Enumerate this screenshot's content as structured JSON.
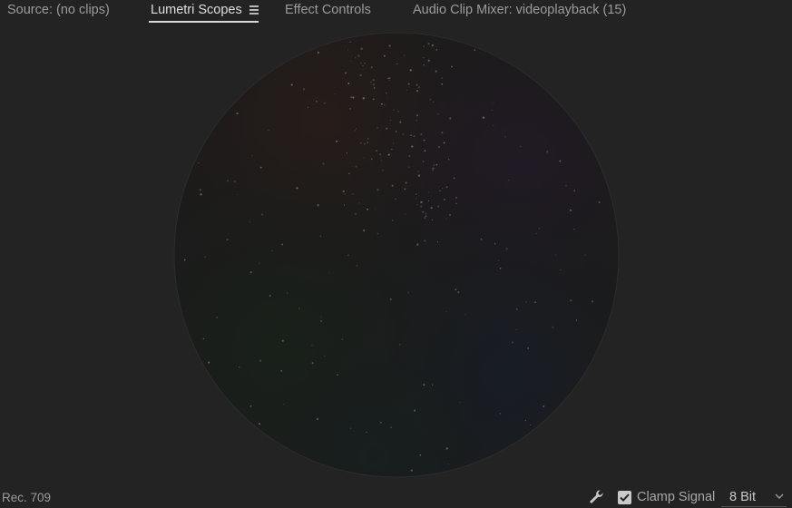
{
  "tabs": [
    {
      "label": "Source: (no clips)",
      "active": false
    },
    {
      "label": "Lumetri Scopes",
      "active": true
    },
    {
      "label": "Effect Controls",
      "active": false
    },
    {
      "label": "Audio Clip Mixer: videoplayback (15)",
      "active": false
    }
  ],
  "tab_menu_icon": "hamburger-menu-icon",
  "scope": {
    "type": "vectorscope",
    "background_color": "#232323",
    "circle_fill": "#1a1a1a"
  },
  "footer": {
    "color_space": "Rec. 709",
    "settings_icon": "wrench-icon",
    "clamp_signal": {
      "label": "Clamp Signal",
      "checked": true
    },
    "bit_depth": {
      "selected": "8 Bit"
    }
  }
}
